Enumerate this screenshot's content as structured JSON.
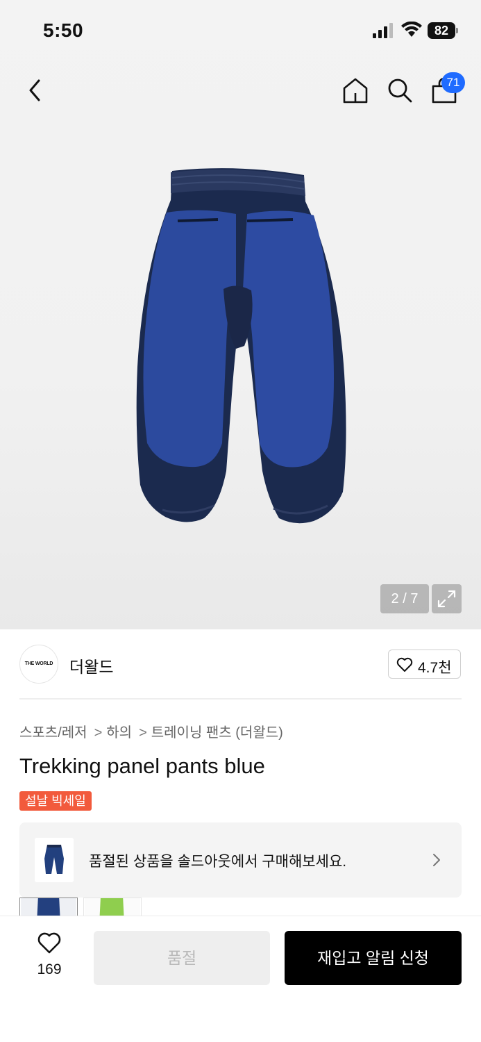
{
  "status_bar": {
    "time": "5:50",
    "battery": "82"
  },
  "header": {
    "cart_count": "71"
  },
  "gallery": {
    "counter": "2 / 7"
  },
  "brand": {
    "logo_text": "THE WORLD",
    "name": "더왈드",
    "likes": "4.7천"
  },
  "breadcrumb": {
    "items": [
      "스포츠/레저",
      "하의",
      "트레이닝 팬츠 (더왈드)"
    ],
    "separator": ">"
  },
  "product": {
    "title": "Trekking panel pants blue",
    "badge": "설날 빅세일"
  },
  "soldout_banner": {
    "text": "품절된 상품을 솔드아웃에서 구매해보세요."
  },
  "bottom_bar": {
    "wish_count": "169",
    "soldout_label": "품절",
    "restock_label": "재입고 알림 신청"
  },
  "colors": {
    "accent_badge": "#1f6bff",
    "sale_badge": "#f25a3c",
    "primary_button": "#000000",
    "disabled_button": "#eeeeee"
  }
}
